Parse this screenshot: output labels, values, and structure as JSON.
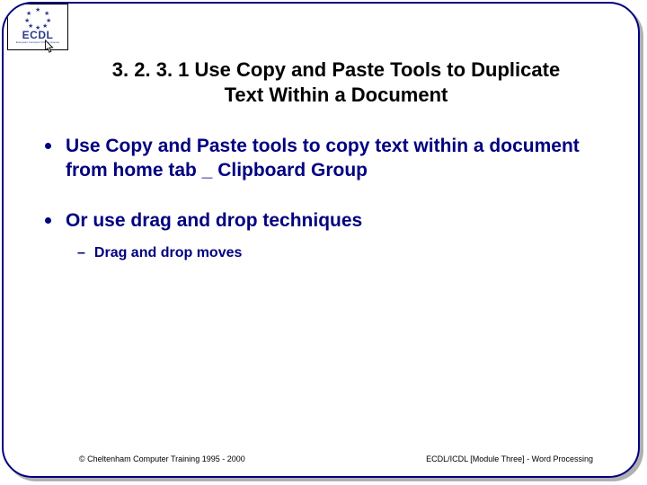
{
  "logo": {
    "acronym": "ECDL",
    "subtitle": "European Computer Driving Licence"
  },
  "title": {
    "line1": "3. 2. 3. 1 Use Copy and Paste Tools to Duplicate",
    "line2": "Text Within a Document"
  },
  "bullets": {
    "b1_pre": "Use ",
    "b1_copy": "Copy",
    "b1_mid": " and ",
    "b1_paste": "Paste",
    "b1_post": " tools to copy text within a document from home tab _ Clipboard Group",
    "b2": "Or use drag and drop techniques",
    "b2_sub": "Drag and drop moves"
  },
  "footer": {
    "left": "© Cheltenham Computer Training 1995 - 2000",
    "right": "ECDL/ICDL [Module Three] - Word Processing"
  }
}
